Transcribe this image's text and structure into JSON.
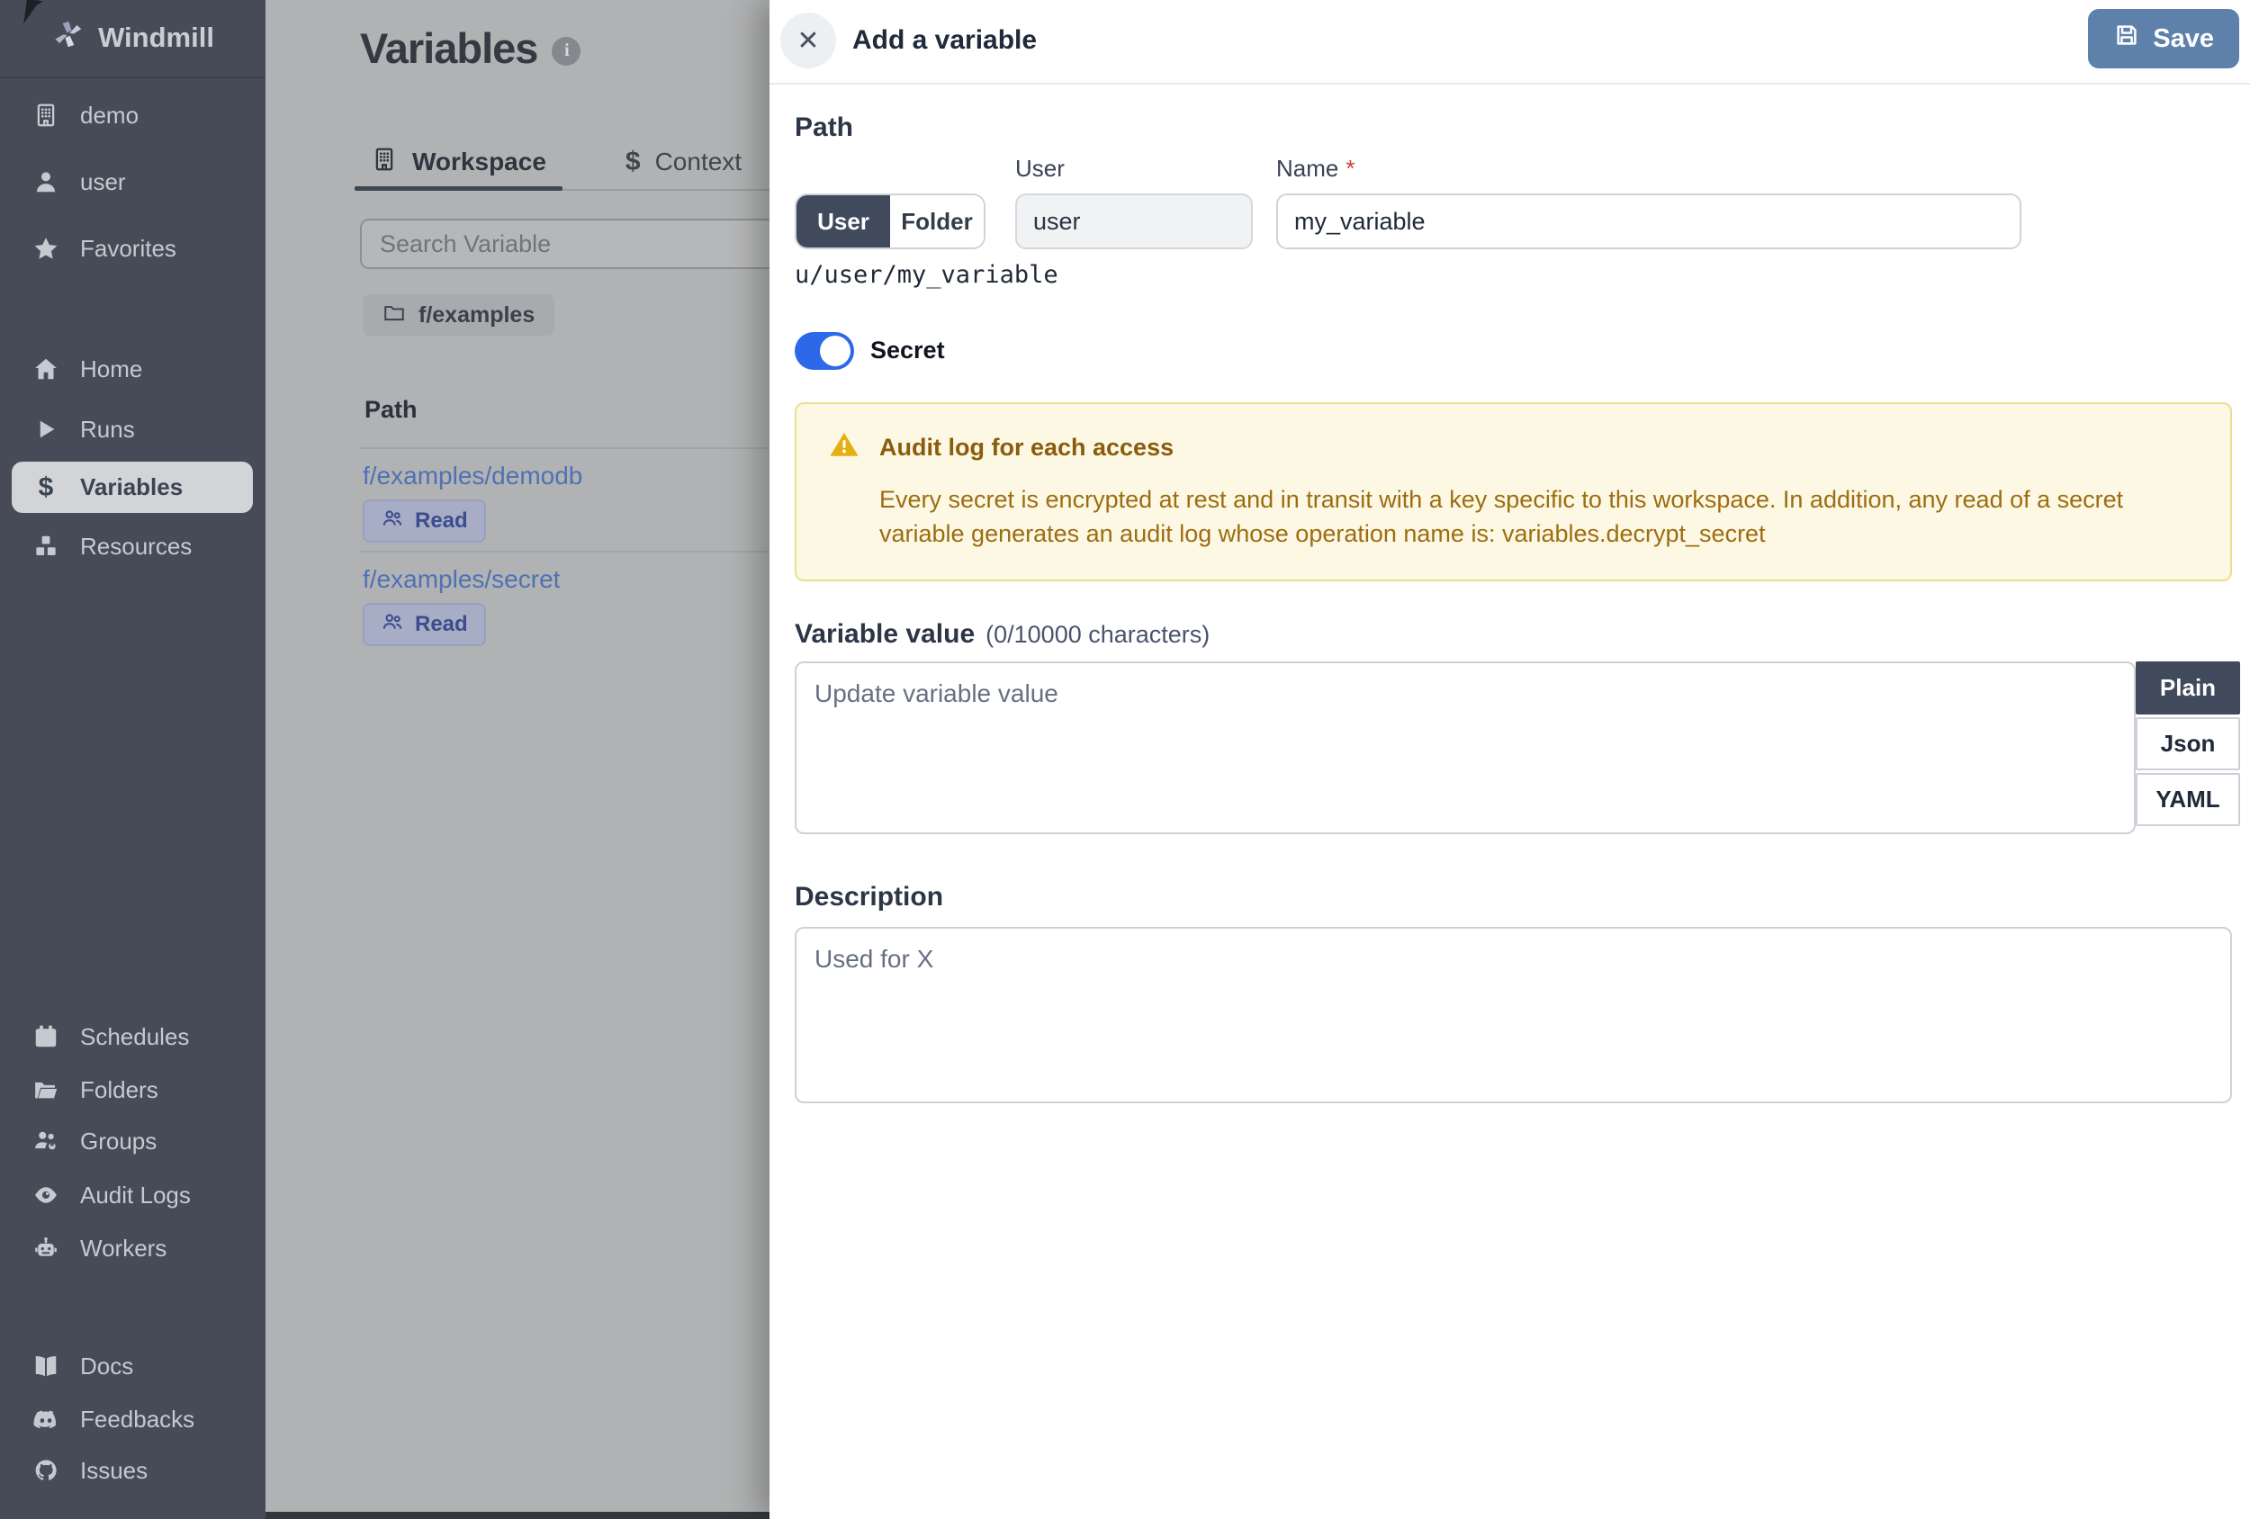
{
  "app": {
    "brand": "Windmill"
  },
  "icons": {
    "close": "✕",
    "dollar": "$",
    "info": "i"
  },
  "colors": {
    "accent_save": "#5e81ac",
    "toggle_on": "#2d68e8",
    "selected_dark": "#404a5c",
    "warning_bg": "#fcf8e3",
    "warning_border": "#eedc96",
    "warning_text": "#9c6d12",
    "link_blue": "#4f71b4",
    "sidebar_bg": "#464b57"
  },
  "sidebar": {
    "workspace_label": "demo",
    "user_label": "user",
    "favorites_label": "Favorites",
    "nav": [
      {
        "label": "Home"
      },
      {
        "label": "Runs"
      },
      {
        "label": "Variables"
      },
      {
        "label": "Resources"
      }
    ],
    "tools": [
      {
        "label": "Schedules"
      },
      {
        "label": "Folders"
      },
      {
        "label": "Groups"
      },
      {
        "label": "Audit Logs"
      },
      {
        "label": "Workers"
      }
    ],
    "links": [
      {
        "label": "Docs"
      },
      {
        "label": "Feedbacks"
      },
      {
        "label": "Issues"
      }
    ]
  },
  "main": {
    "title": "Variables",
    "tabs": [
      {
        "label": "Workspace"
      },
      {
        "label": "Context"
      }
    ],
    "search_placeholder": "Search Variable",
    "folder_chip": "f/examples",
    "path_header": "Path",
    "rows": [
      {
        "path": "f/examples/demodb",
        "permission": "Read"
      },
      {
        "path": "f/examples/secret",
        "permission": "Read"
      }
    ]
  },
  "drawer": {
    "title": "Add a variable",
    "save_label": "Save",
    "path": {
      "heading": "Path",
      "owner_options": [
        "User",
        "Folder"
      ],
      "selected_owner": "User",
      "user_label": "User",
      "user_value": "user",
      "name_label": "Name",
      "required_mark": "*",
      "name_value": "my_variable",
      "preview": "u/user/my_variable"
    },
    "secret": {
      "label": "Secret",
      "enabled": true
    },
    "warning": {
      "title": "Audit log for each access",
      "body": "Every secret is encrypted at rest and in transit with a key specific to this workspace. In addition, any read of a secret variable generates an audit log whose operation name is: variables.decrypt_secret"
    },
    "value_section": {
      "heading": "Variable value",
      "counter": "(0/10000 characters)",
      "placeholder": "Update variable value",
      "formats": [
        "Plain",
        "Json",
        "YAML"
      ],
      "selected_format": "Plain"
    },
    "description": {
      "heading": "Description",
      "placeholder": "Used for X"
    }
  }
}
